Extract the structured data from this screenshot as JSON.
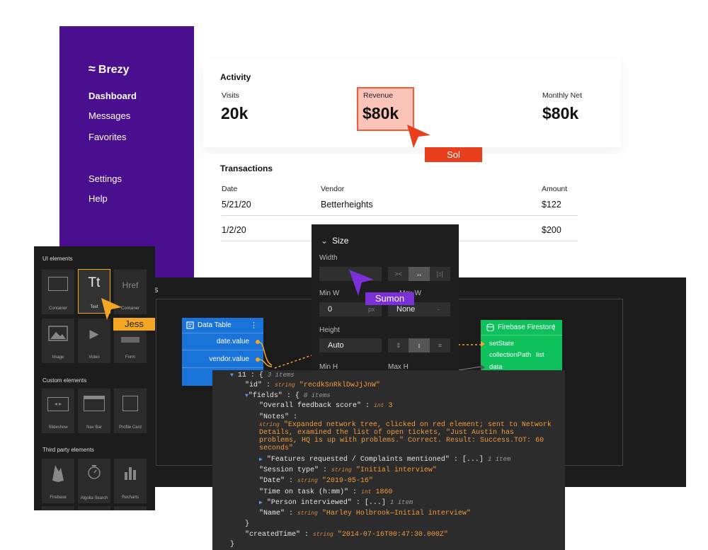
{
  "brezy": {
    "logo": "Brezy",
    "nav": [
      "Dashboard",
      "Messages",
      "Favorites",
      "Settings",
      "Help"
    ],
    "activity": {
      "title": "Activity",
      "stats": [
        {
          "label": "Visits",
          "value": "20k"
        },
        {
          "label": "Revenue",
          "value": "$80k"
        },
        {
          "label": "Monthly Net",
          "value": "$80k"
        }
      ]
    },
    "transactions": {
      "title": "Transactions",
      "columns": [
        "Date",
        "Vendor",
        "Amount"
      ],
      "rows": [
        [
          "5/21/20",
          "Betterheights",
          "$122"
        ],
        [
          "1/2/20",
          "",
          "$200"
        ]
      ]
    }
  },
  "cursors": {
    "sol": {
      "name": "Sol",
      "color": "#e8401c"
    },
    "sumon": {
      "name": "Sumon",
      "color": "#7b2fd6"
    },
    "jess": {
      "name": "Jess",
      "color": "#f5a623"
    }
  },
  "canvas": {
    "title_fragment": "ts"
  },
  "size_panel": {
    "title": "Size",
    "width_label": "Width",
    "min_w_label": "Min W",
    "max_w_label": "Max W",
    "min_w_value": "0",
    "min_w_unit": "px",
    "max_w_value": "None",
    "max_w_unit": "-",
    "height_label": "Height",
    "height_value": "Auto",
    "min_h_label": "Min H",
    "max_h_label": "Max H",
    "mode_icons": [
      "><",
      "↔",
      "|↕|"
    ],
    "height_mode_icons": [
      "⇕",
      "↕",
      "≡"
    ]
  },
  "data_table_node": {
    "title": "Data Table",
    "rows": [
      "date.value",
      "vendor.value"
    ]
  },
  "firestore_node": {
    "title": "Firebase Firestore",
    "rows": [
      "setState",
      "collectionPath",
      "data"
    ],
    "collection_type": "list"
  },
  "palette": {
    "sections": [
      {
        "title": "UI elements",
        "items": [
          "Container",
          "Text",
          "Container",
          "Image",
          "Video",
          "Form"
        ]
      },
      {
        "title": "Custom elements",
        "items": [
          "Slideshow",
          "Nav Bar",
          "Profile Card"
        ]
      },
      {
        "title": "Third party elements",
        "items": [
          "Firebase",
          "Algolia Search",
          "Recharts"
        ]
      }
    ],
    "text_glyph": "Tt",
    "href_glyph": "Href"
  },
  "json": {
    "root_key": "11",
    "root_count": "3 items",
    "id_key": "\"id\"",
    "id_value": "\"recdkSnRklDwJjJnW\"",
    "fields_key": "\"fields\"",
    "fields_count": "8 items",
    "feedback_key": "\"Overall feedback score\"",
    "feedback_value": "3",
    "notes_key": "\"Notes\"",
    "notes_value": [
      "\"Expanded network tree, clicked on red element; sent to Network",
      "Details, examined the list of open tickets, \"Just Austin has",
      "problems, HQ is up with problems.\" Correct. Result: Success.TOT: 60",
      "seconds\""
    ],
    "features_key": "\"Features requested / Complaints mentioned\"",
    "features_count": "1 item",
    "session_key": "\"Session type\"",
    "session_value": "\"Initial interview\"",
    "date_key": "\"Date\"",
    "date_value": "\"2019-05-16\"",
    "time_key": "\"Time on task (h:mm)\"",
    "time_value": "1860",
    "person_key": "\"Person interviewed\"",
    "person_count": "1 item",
    "name_key": "\"Name\"",
    "name_value": "\"Harley Holbrook—Initial interview\"",
    "created_key": "\"createdTime\"",
    "created_value": "\"2014-07-16T00:47:30.000Z\"",
    "type_string": "string",
    "type_int": "int"
  }
}
